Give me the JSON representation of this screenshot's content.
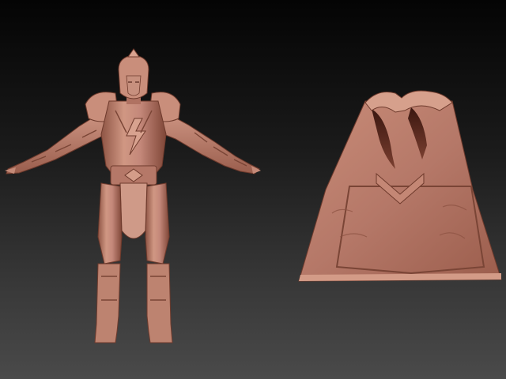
{
  "viewport": {
    "background_top": "#040404",
    "background_bottom": "#4a4a4a"
  },
  "materials": {
    "clay_base": "#b87968",
    "clay_light": "#d39a86",
    "clay_highlight": "#e6b3a0",
    "clay_shadow": "#7a4536",
    "clay_deep": "#4f241b"
  },
  "objects": [
    {
      "name": "armored-warrior-figure",
      "pose": "T-pose"
    },
    {
      "name": "cape-model"
    }
  ]
}
